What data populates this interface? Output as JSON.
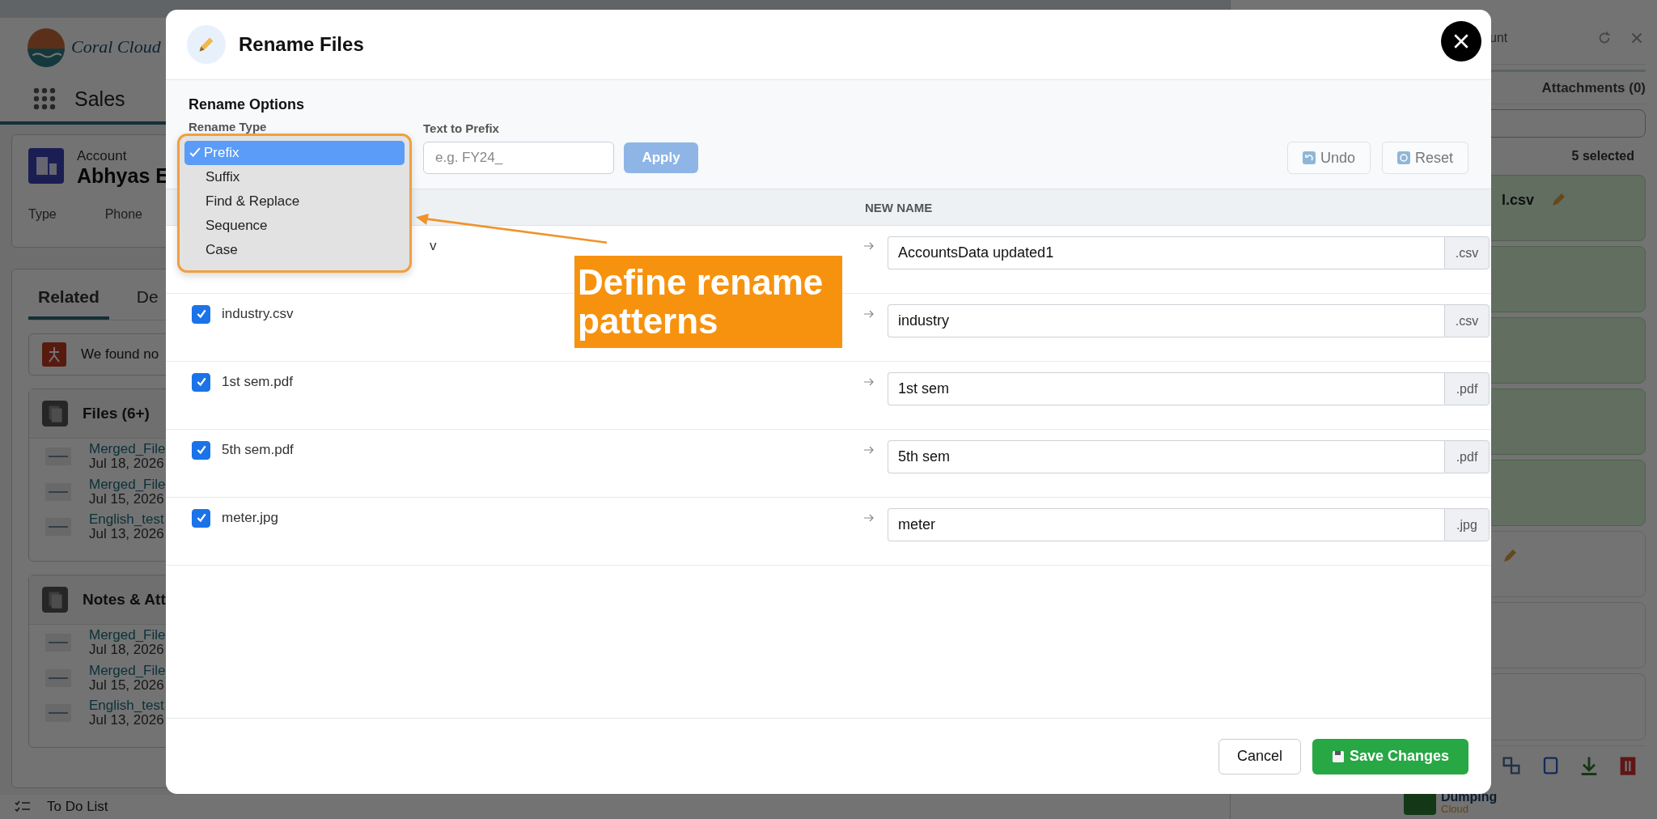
{
  "background": {
    "app_name": "Coral Cloud",
    "nav_label": "Sales",
    "account": {
      "object_label": "Account",
      "name": "Abhyas E",
      "fields": [
        "Type",
        "Phone"
      ]
    },
    "tabs": [
      {
        "label": "Related",
        "selected": true
      },
      {
        "label": "De",
        "selected": false
      }
    ],
    "notice": "We found no",
    "files": {
      "title": "Files (6+)",
      "items": [
        {
          "name": "Merged_File",
          "date": "Jul 18, 2026"
        },
        {
          "name": "Merged_File",
          "date": "Jul 15, 2026"
        },
        {
          "name": "English_test",
          "date": "Jul 13, 2026"
        }
      ]
    },
    "notes": {
      "title": "Notes & Att",
      "items": [
        {
          "name": "Merged_File",
          "date": "Jul 18, 2026"
        },
        {
          "name": "Merged_File",
          "date": "Jul 15, 2026"
        },
        {
          "name": "English_test",
          "date": "Jul 13, 2026"
        }
      ]
    },
    "footer": "To Do List"
  },
  "right_panel": {
    "title_fragment": "unt",
    "attachments_tab": "Attachments (0)",
    "selected_count": "5 selected",
    "cards": [
      {
        "name": "l.csv",
        "selected": true,
        "editable": true
      },
      {
        "selected": true,
        "editable": false
      },
      {
        "selected": true,
        "editable": false
      },
      {
        "selected": true,
        "editable": false
      },
      {
        "selected": true,
        "editable": false
      },
      {
        "selected": false,
        "editable": true
      },
      {
        "selected": false,
        "editable": false
      },
      {
        "selected": false,
        "editable": false
      }
    ],
    "logo": {
      "line1": "Dumping",
      "line2": "Cloud"
    }
  },
  "dialog": {
    "title": "Rename Files",
    "section_title": "Rename Options",
    "type_label": "Rename Type",
    "type_options": [
      {
        "label": "Prefix",
        "selected": true
      },
      {
        "label": "Suffix",
        "selected": false
      },
      {
        "label": "Find & Replace",
        "selected": false
      },
      {
        "label": "Sequence",
        "selected": false
      },
      {
        "label": "Case",
        "selected": false
      }
    ],
    "text_label": "Text to Prefix",
    "text_field": {
      "placeholder": "e.g. FY24_"
    },
    "apply": "Apply",
    "undo": "Undo",
    "reset": "Reset",
    "table": {
      "columns": [
        "NEW NAME"
      ],
      "rows": [
        {
          "kind": "covered",
          "original_name": "v",
          "new_name": "AccountsData updated1",
          "extension": ".csv"
        },
        {
          "kind": "plain",
          "checked": true,
          "original_name": "industry.csv",
          "new_name": "industry",
          "extension": ".csv"
        },
        {
          "kind": "plain",
          "checked": true,
          "original_name": "1st sem.pdf",
          "new_name": "1st sem",
          "extension": ".pdf"
        },
        {
          "kind": "plain",
          "checked": true,
          "original_name": "5th sem.pdf",
          "new_name": "5th sem",
          "extension": ".pdf"
        },
        {
          "kind": "plain",
          "checked": true,
          "original_name": "meter.jpg",
          "new_name": "meter",
          "extension": ".jpg"
        }
      ]
    },
    "cancel": "Cancel",
    "save": "Save Changes"
  },
  "callout": {
    "line1": "Define rename",
    "line2": "patterns"
  }
}
